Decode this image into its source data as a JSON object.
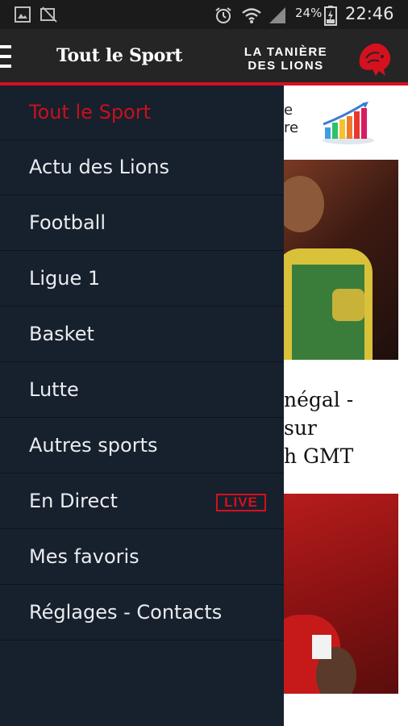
{
  "statusbar": {
    "icons_left": [
      "image-icon",
      "no-sim-icon"
    ],
    "icons_right": [
      "alarm-icon",
      "wifi-icon",
      "signal-icon"
    ],
    "battery_percent": "24%",
    "time": "22:46"
  },
  "appbar": {
    "title": "Tout le Sport",
    "brand_line1": "LA TANIÈRE",
    "brand_line2": "DES LIONS",
    "accent_color": "#d5101f"
  },
  "drawer": {
    "items": [
      {
        "label": "Tout le Sport",
        "active": true
      },
      {
        "label": "Actu des Lions"
      },
      {
        "label": "Football"
      },
      {
        "label": "Ligue 1"
      },
      {
        "label": "Basket"
      },
      {
        "label": "Lutte"
      },
      {
        "label": "Autres sports"
      },
      {
        "label": "En Direct",
        "badge": "LIVE"
      },
      {
        "label": "Mes favoris"
      },
      {
        "label": "Réglages - Contacts"
      }
    ]
  },
  "content": {
    "promo_text_line1": "e",
    "promo_text_line2": "re",
    "headline_line1": "négal -",
    "headline_line2": "sur",
    "headline_line3": "h GMT"
  }
}
